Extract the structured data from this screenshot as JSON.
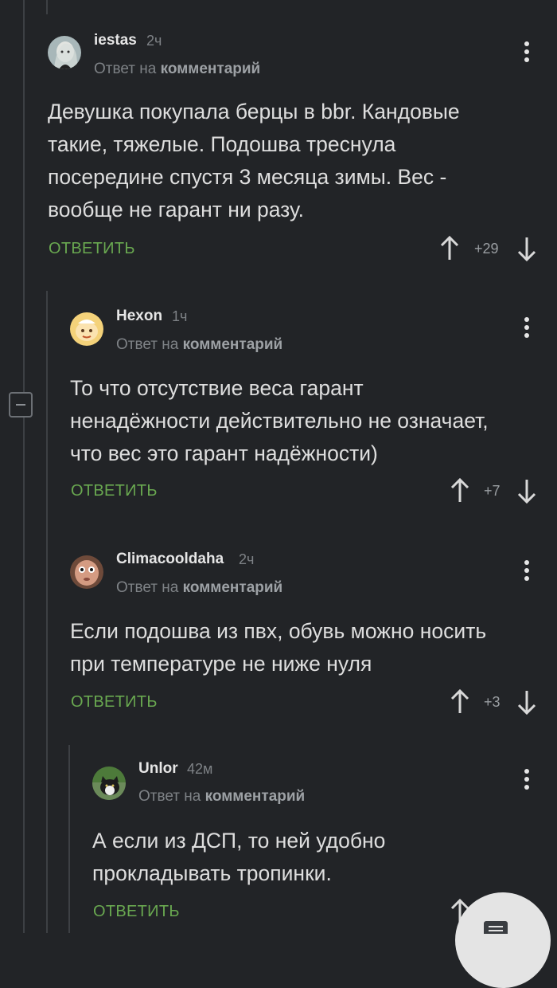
{
  "comments": [
    {
      "author": "iestas",
      "time": "2ч",
      "reply_prefix": "Ответ на",
      "reply_link": "комментарий",
      "lines": [
        "Девушка покупала берцы в bbr. Кандовые",
        "такие, тяжелые. Подошва треснула",
        "посередине спустя 3 месяца зимы. Вес -",
        "вообще не гарант ни разу."
      ],
      "reply_label": "ОТВЕТИТЬ",
      "score": "+29"
    },
    {
      "author": "Hexon",
      "time": "1ч",
      "reply_prefix": "Ответ на",
      "reply_link": "комментарий",
      "lines": [
        "То что отсутствие веса гарант",
        "ненадёжности действительно не означает,",
        "что вес это гарант надёжности)"
      ],
      "reply_label": "ОТВЕТИТЬ",
      "score": "+7"
    },
    {
      "author": "Climacooldaha",
      "time": "2ч",
      "reply_prefix": "Ответ на",
      "reply_link": "комментарий",
      "lines": [
        "Если подошва из пвх, обувь можно носить",
        "при температуре не ниже нуля"
      ],
      "reply_label": "ОТВЕТИТЬ",
      "score": "+3"
    },
    {
      "author": "Unlor",
      "time": "42м",
      "reply_prefix": "Ответ на",
      "reply_link": "комментарий",
      "lines": [
        "А если из ДСП, то ней удобно",
        "прокладывать тропинки."
      ],
      "reply_label": "ОТВЕТИТЬ"
    }
  ],
  "colors": {
    "background": "#222427",
    "accent_green": "#69a850",
    "muted": "#7e8286"
  }
}
